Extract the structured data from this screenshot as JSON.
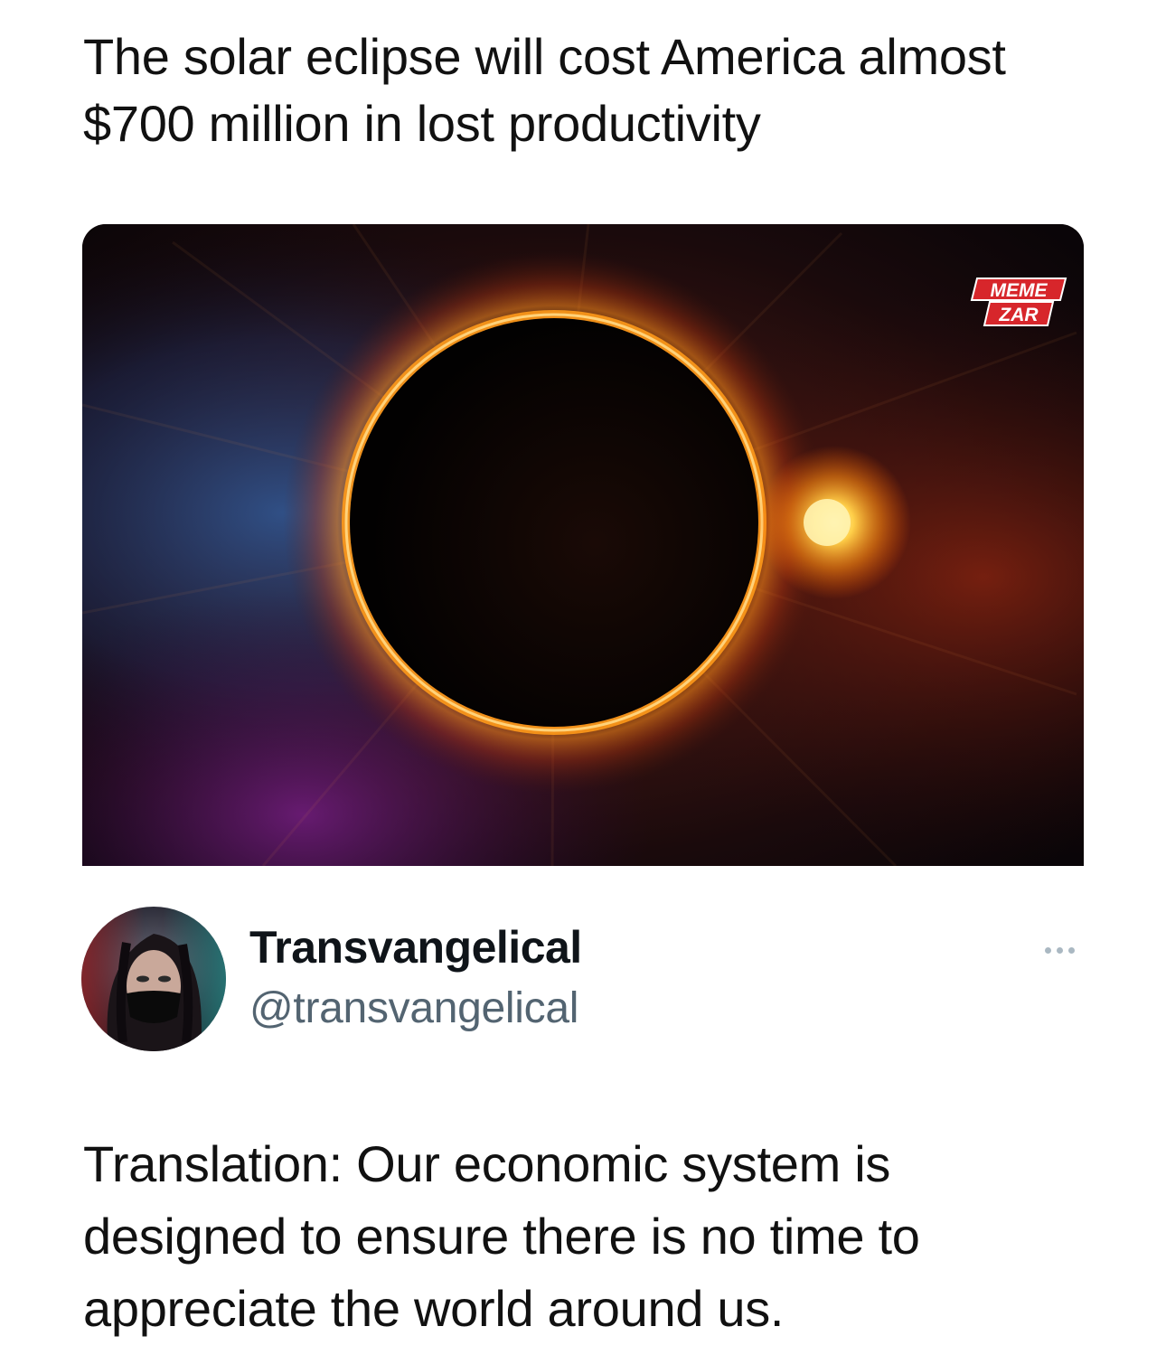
{
  "quoted_post": {
    "headline": "The solar eclipse will cost America almost $700 million in lost productivity",
    "image": {
      "subject": "eclipse-image",
      "watermark": {
        "top": "MEME",
        "bottom": "ZAR"
      }
    }
  },
  "author": {
    "display_name": "Transvangelical",
    "handle": "@transvangelical",
    "avatar": "profile-photo"
  },
  "more_menu_icon": "more-horizontal-icon",
  "tweet": {
    "text": "Translation: Our economic system is designed to ensure there is no time to appreciate the world around us."
  },
  "colors": {
    "text_primary": "#0f1419",
    "text_secondary": "#536471",
    "watermark_red": "#d7262b",
    "corona_orange": "#ff9a1a"
  }
}
